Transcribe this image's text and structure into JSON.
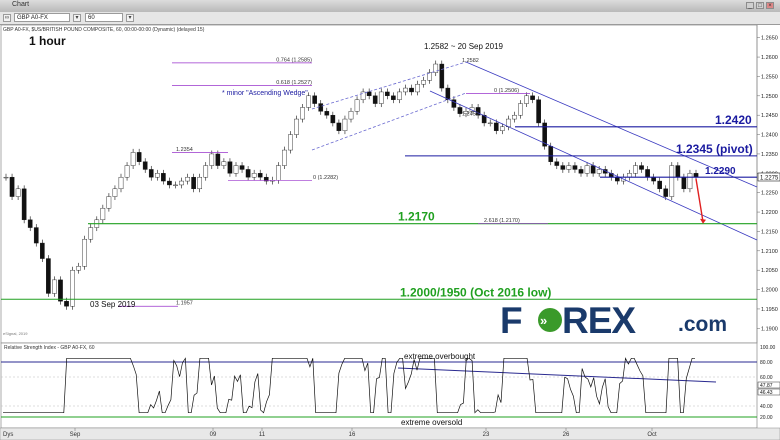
{
  "window": {
    "title": "Chart"
  },
  "toolbar": {
    "symbol": "GBP A0-FX",
    "interval": "60"
  },
  "chart_data": {
    "type": "candlestick",
    "title": "GBP A0-FX, $US/BRITISH POUND COMPOSITE, 60, 00:00-00:00 (Dynamic) (delayed 15)",
    "timeframe_label": "1 hour",
    "x_labels": [
      "Sep",
      "09",
      "11",
      "16",
      "23",
      "26",
      "Oct"
    ],
    "y_ticks": [
      "1.2650",
      "1.2600",
      "1.2550",
      "1.2500",
      "1.2450",
      "1.2400",
      "1.2350",
      "1.2300",
      "1.2250",
      "1.2200",
      "1.2150",
      "1.2100",
      "1.2050",
      "1.2000",
      "1.1950",
      "1.1900"
    ],
    "ylim": [
      1.1875,
      1.2675
    ],
    "last_price": "1.2275",
    "price_path": [
      1.229,
      1.224,
      1.226,
      1.218,
      1.216,
      1.212,
      1.208,
      1.199,
      1.2025,
      1.197,
      1.1957,
      1.205,
      1.206,
      1.213,
      1.216,
      1.218,
      1.221,
      1.224,
      1.226,
      1.229,
      1.232,
      1.2354,
      1.233,
      1.231,
      1.229,
      1.23,
      1.228,
      1.227,
      1.227,
      1.228,
      1.229,
      1.226,
      1.229,
      1.232,
      1.235,
      1.232,
      1.233,
      1.23,
      1.232,
      1.231,
      1.229,
      1.23,
      1.229,
      1.228,
      1.2282,
      1.232,
      1.236,
      1.24,
      1.244,
      1.247,
      1.25,
      1.248,
      1.246,
      1.245,
      1.243,
      1.241,
      1.244,
      1.246,
      1.249,
      1.251,
      1.25,
      1.248,
      1.251,
      1.25,
      1.249,
      1.251,
      1.252,
      1.251,
      1.253,
      1.254,
      1.256,
      1.2582,
      1.252,
      1.249,
      1.247,
      1.2454,
      1.246,
      1.247,
      1.245,
      1.243,
      1.243,
      1.241,
      1.242,
      1.244,
      1.245,
      1.248,
      1.25,
      1.249,
      1.243,
      1.237,
      1.233,
      1.232,
      1.231,
      1.232,
      1.231,
      1.23,
      1.232,
      1.23,
      1.231,
      1.23,
      1.229,
      1.228,
      1.229,
      1.23,
      1.232,
      1.231,
      1.229,
      1.228,
      1.226,
      1.224,
      1.232,
      1.229,
      1.226,
      1.23,
      1.229
    ],
    "projection": {
      "from": 1.2286,
      "to": 1.2175,
      "color": "#e02020"
    },
    "horizontal_levels": [
      {
        "label": "1.2420",
        "value": 1.242,
        "color": "#1a1aa0"
      },
      {
        "label": "1.2345 (pivot)",
        "value": 1.2345,
        "color": "#1a1aa0"
      },
      {
        "label": "1.2290",
        "value": 1.229,
        "color": "#1a1aa0"
      },
      {
        "label": "1.2170",
        "value": 1.217,
        "color": "#20a020"
      },
      {
        "label": "1.2000/1950 (Oct 2016 low)",
        "value": 1.1975,
        "color": "#20a020"
      }
    ],
    "fib_levels": [
      {
        "label": "0.764 (1.2585)",
        "value": 1.2585
      },
      {
        "label": "0.618 (1.2527)",
        "value": 1.2527
      },
      {
        "label": "1.2354",
        "value": 1.2354
      },
      {
        "label": "0 (1.2282)",
        "value": 1.2282
      },
      {
        "label": "1.1957",
        "value": 1.1957
      },
      {
        "label": "0 (1.2506)",
        "value": 1.2506
      },
      {
        "label": "2.618 (1.2170)",
        "value": 1.217
      }
    ],
    "point_labels": [
      "1.2582",
      "1.2454"
    ],
    "annotations": {
      "high": "1.2582 ~ 20 Sep 2019",
      "low": "03 Sep 2019",
      "wedge": "* minor \"Ascending Wedge\""
    },
    "rsi": {
      "title": "Relative Strength Index - GBP A0-FX, 60",
      "ticks": [
        "100.00",
        "80.00",
        "60.00",
        "40.00",
        "20.00"
      ],
      "current_values": [
        "47.87",
        "46.43"
      ],
      "overbought_label": "extreme overbought",
      "oversold_label": "extreme oversold"
    },
    "watermark": "eSignal, 2019",
    "logo": "FOREX.com"
  }
}
